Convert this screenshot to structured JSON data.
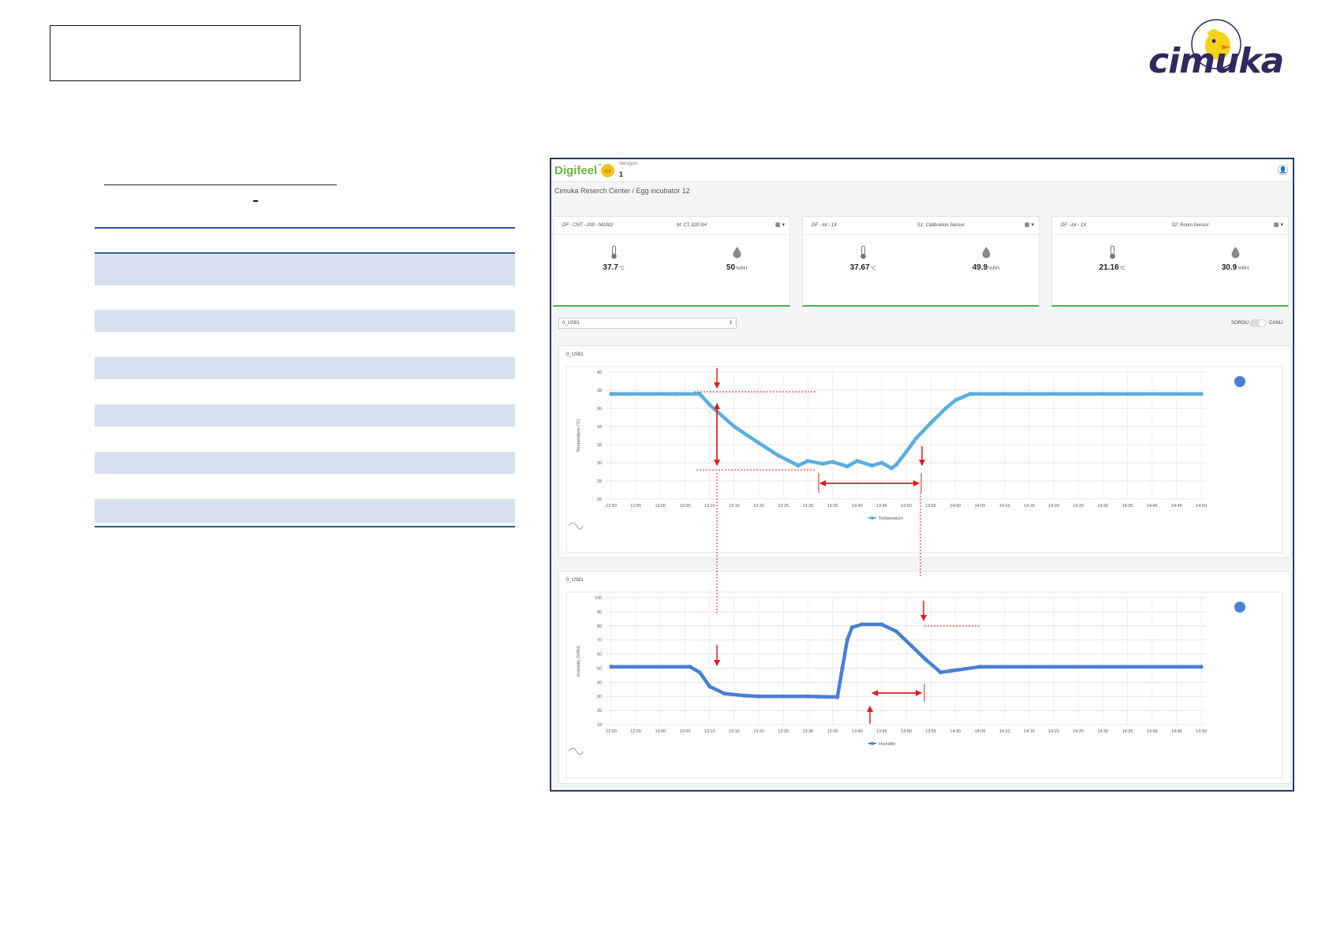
{
  "header": {
    "logo_text": "cimuka"
  },
  "left_panel": {
    "dash_text": "-",
    "table_rows": 10
  },
  "dashboard": {
    "brand": "Digifeel",
    "brand_tm": "™",
    "device_icon": "laptop-icon",
    "version_label": "Versiyon",
    "version_value": "1",
    "user_icon": "user-icon",
    "breadcrumb": "Cimuka Reserch Center / Egg incubator 12",
    "menu_icon": "▦ ▾",
    "cards": [
      {
        "device": "DF - CNT - 200 - M1002",
        "name": "M: CT 320 SH",
        "temperature": "37.7",
        "temp_unit": "°C",
        "humidity": "50",
        "hum_unit": "%RH"
      },
      {
        "device": "DF - lot - 1X",
        "name": "S1: Calibration Sensor",
        "temperature": "37.67",
        "temp_unit": "°C",
        "humidity": "49.9",
        "hum_unit": "%RH"
      },
      {
        "device": "DF - lot - 1X",
        "name": "S2: Room Sensor",
        "temperature": "21.16",
        "temp_unit": "°C",
        "humidity": "30.9",
        "hum_unit": "%RH"
      }
    ],
    "select_value": "0_US81",
    "toggle_left": "SORGU",
    "toggle_right": "CANLI",
    "accent": "#6ab344"
  },
  "chart_data": [
    {
      "type": "line",
      "panel_title": "0_US81",
      "ylabel": "Temperature (°C)",
      "legend": "Temperature",
      "color": "#5aaedc",
      "ylim": [
        26,
        40
      ],
      "yticks": [
        26,
        28,
        30,
        32,
        34,
        36,
        38,
        40
      ],
      "x_ticks": [
        "12:50",
        "12:55",
        "13:00",
        "13:05",
        "13:10",
        "13:15",
        "13:20",
        "13:25",
        "13:30",
        "13:35",
        "13:40",
        "13:45",
        "13:50",
        "13:55",
        "14:00",
        "14:05",
        "14:10",
        "14:15",
        "14:20",
        "14:25",
        "14:30",
        "14:35",
        "14:40",
        "14:45",
        "14:50"
      ],
      "series": [
        {
          "x": [
            "12:50",
            "13:03",
            "13:08",
            "13:10",
            "13:15",
            "13:20",
            "13:24",
            "13:28",
            "13:30",
            "13:33",
            "13:35",
            "13:38",
            "13:40",
            "13:43",
            "13:45",
            "13:47",
            "13:48",
            "13:50",
            "13:52",
            "13:55",
            "13:58",
            "14:00",
            "14:03",
            "14:50"
          ],
          "y": [
            37.6,
            37.6,
            37.6,
            36.4,
            34.0,
            32.2,
            30.8,
            29.7,
            30.2,
            29.9,
            30.1,
            29.6,
            30.2,
            29.7,
            30.0,
            29.4,
            29.8,
            31.2,
            32.7,
            34.4,
            36.0,
            36.9,
            37.6,
            37.6
          ]
        }
      ]
    },
    {
      "type": "line",
      "panel_title": "0_US81",
      "ylabel": "Humidity (%RH)",
      "legend": "Humidity",
      "color": "#4a7fd6",
      "ylim": [
        10,
        100
      ],
      "yticks": [
        10,
        20,
        30,
        40,
        50,
        60,
        70,
        80,
        90,
        100
      ],
      "x_ticks": [
        "12:50",
        "12:55",
        "13:00",
        "13:05",
        "13:10",
        "13:15",
        "13:20",
        "13:25",
        "13:30",
        "13:35",
        "13:40",
        "13:45",
        "13:50",
        "13:55",
        "14:00",
        "14:05",
        "14:10",
        "14:15",
        "14:20",
        "14:25",
        "14:30",
        "14:35",
        "14:40",
        "14:45",
        "14:50"
      ],
      "series": [
        {
          "x": [
            "12:50",
            "13:06",
            "13:08",
            "13:10",
            "13:13",
            "13:17",
            "13:20",
            "13:30",
            "13:36",
            "13:37",
            "13:38",
            "13:39",
            "13:41",
            "13:45",
            "13:48",
            "13:51",
            "13:54",
            "13:57",
            "13:59",
            "14:05",
            "14:50"
          ],
          "y": [
            51,
            51,
            47,
            37,
            32,
            30.5,
            30,
            30,
            29.5,
            50,
            70,
            79,
            81,
            81,
            76,
            66,
            56,
            47,
            48,
            51,
            51
          ]
        }
      ]
    }
  ]
}
